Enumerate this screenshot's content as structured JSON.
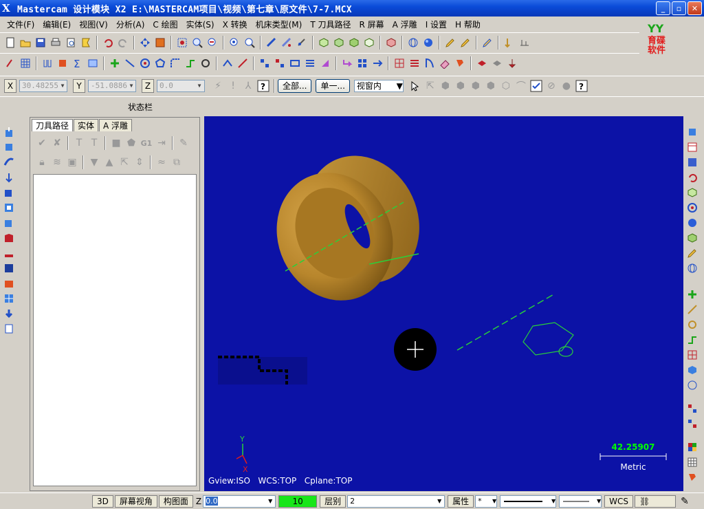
{
  "window": {
    "app_icon": "X",
    "title": "Mastercam 设计模块  X2  E:\\MASTERCAM项目\\视频\\第七章\\原文件\\7-7.MCX",
    "min": "_",
    "max": "▫",
    "close": "✕"
  },
  "menu": [
    "文件(F)",
    "编辑(E)",
    "视图(V)",
    "分析(A)",
    "C 绘图",
    "实体(S)",
    "X 转换",
    "机床类型(M)",
    "T 刀具路径",
    "R 屏幕",
    "A 浮雕",
    "I 设置",
    "H 帮助"
  ],
  "logo": {
    "line1": "育碟",
    "line2": "软件"
  },
  "coords": {
    "x_label": "X",
    "x_value": "30.48255",
    "y_label": "Y",
    "y_value": "-51.0886",
    "z_label": "Z",
    "z_value": "0.0",
    "btn_all": "全部...",
    "btn_single": "单一...",
    "select_mode": "视窗内"
  },
  "status_bar_label": "状态栏",
  "panel": {
    "tabs": [
      "刀具路径",
      "实体",
      "A 浮雕"
    ],
    "tool_g1": "G1"
  },
  "viewport": {
    "gview": "Gview:ISO",
    "wcs": "WCS:TOP",
    "cplane": "Cplane:TOP",
    "scale_value": "42.25907",
    "scale_unit": "Metric",
    "axis_y": "Y",
    "axis_x": "X",
    "colors": {
      "background": "#0c12a6",
      "part": "#b8862c",
      "wireframe": "#29d13a"
    }
  },
  "bottom": {
    "btn_3d": "3D",
    "btn_screen_view": "屏幕视角",
    "btn_plane": "构图面",
    "z_label": "Z",
    "z_value": "0.0",
    "color_value": "10",
    "layer_label": "层别",
    "layer_value": "2",
    "attr_label": "属性",
    "wcs": "WCS"
  }
}
